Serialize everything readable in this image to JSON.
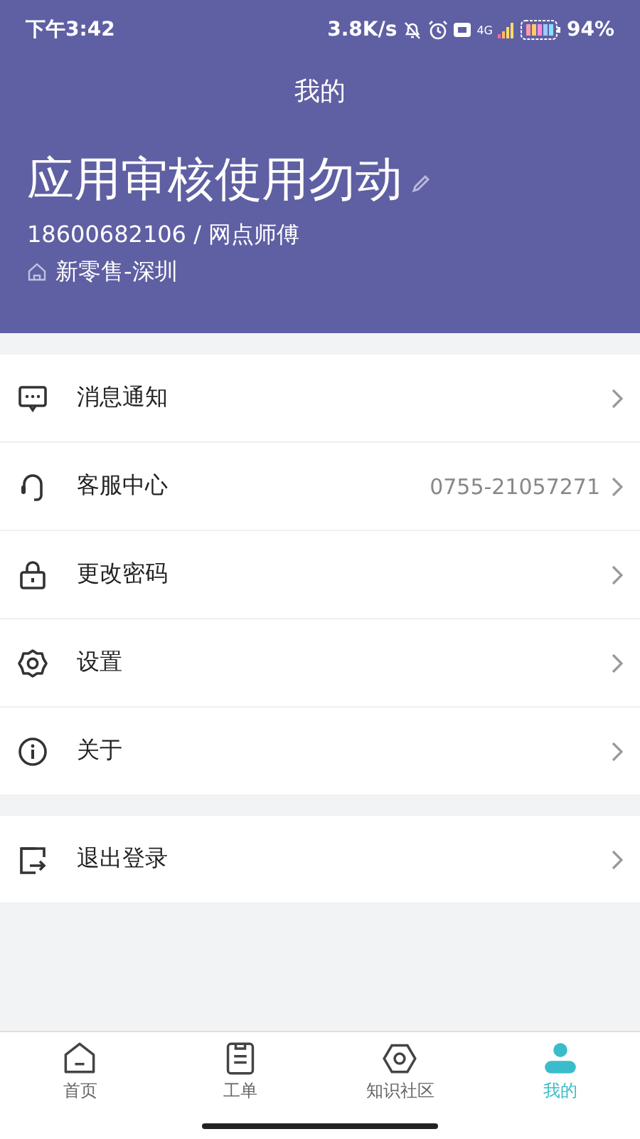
{
  "status_bar": {
    "time": "下午3:42",
    "speed": "3.8K/s",
    "network": "4G",
    "battery": "94%"
  },
  "header": {
    "title": "我的",
    "name": "应用审核使用勿动",
    "account": "18600682106 / 网点师傅",
    "store": "新零售-深圳"
  },
  "menu_groups": [
    [
      {
        "kind": "message",
        "label": "消息通知"
      },
      {
        "kind": "headset",
        "label": "客服中心",
        "value": "0755-21057271"
      },
      {
        "kind": "lock",
        "label": "更改密码"
      },
      {
        "kind": "gear",
        "label": "设置"
      },
      {
        "kind": "info",
        "label": "关于"
      }
    ],
    [
      {
        "kind": "logout",
        "label": "退出登录"
      }
    ]
  ],
  "tabs": [
    {
      "kind": "home",
      "label": "首页",
      "selected": false
    },
    {
      "kind": "clipboard",
      "label": "工单",
      "selected": false
    },
    {
      "kind": "hexagon",
      "label": "知识社区",
      "selected": false
    },
    {
      "kind": "person",
      "label": "我的",
      "selected": true
    }
  ]
}
